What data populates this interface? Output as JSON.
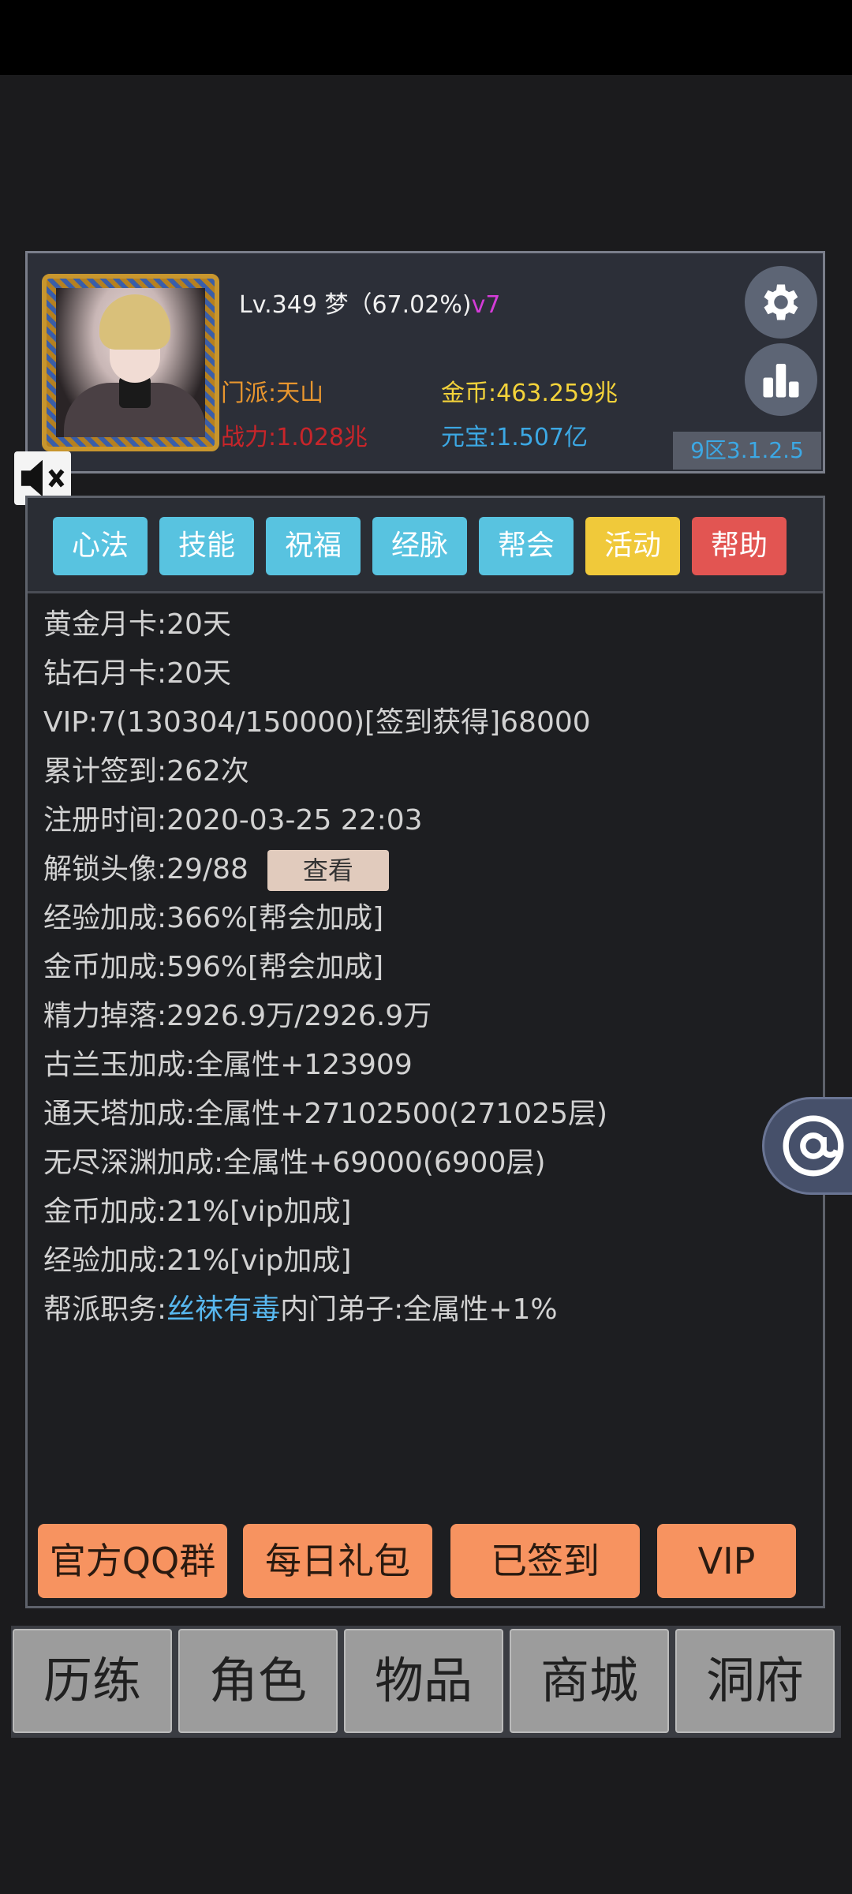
{
  "player": {
    "level_line": "Lv.349 梦（67.02%)",
    "vip_tag": "v7",
    "sect": "门派:天山",
    "power": "战力:1.028兆",
    "gold": "金币:463.259兆",
    "ingot": "元宝:1.507亿",
    "version": "9区3.1.2.5"
  },
  "tabs": [
    {
      "label": "心法",
      "color": "#58c3e0"
    },
    {
      "label": "技能",
      "color": "#58c3e0"
    },
    {
      "label": "祝福",
      "color": "#58c3e0"
    },
    {
      "label": "经脉",
      "color": "#58c3e0"
    },
    {
      "label": "帮会",
      "color": "#58c3e0"
    },
    {
      "label": "活动",
      "color": "#f0c93a"
    },
    {
      "label": "帮助",
      "color": "#e25552"
    }
  ],
  "info": {
    "gold_card": "黄金月卡:20天",
    "diamond_card": "钻石月卡:20天",
    "vip": "VIP:7(130304/150000)[签到获得]68000",
    "checkin_total": "累计签到:262次",
    "register_time": "注册时间:2020-03-25 22:03",
    "avatars_unlocked": "解锁头像:29/88",
    "view_button": "查看",
    "exp_bonus_guild": "经验加成:366%[帮会加成]",
    "gold_bonus_guild": "金币加成:596%[帮会加成]",
    "energy_drop": "精力掉落:2926.9万/2926.9万",
    "gulan_jade": "古兰玉加成:全属性+123909",
    "tower_bonus": "通天塔加成:全属性+27102500(271025层)",
    "abyss_bonus": "无尽深渊加成:全属性+69000(6900层)",
    "gold_bonus_vip": "金币加成:21%[vip加成]",
    "exp_bonus_vip": "经验加成:21%[vip加成]",
    "guild_role_prefix": "帮派职务:",
    "guild_name": "丝袜有毒",
    "guild_role_suffix": "内门弟子:全属性+1%"
  },
  "bottom_buttons": [
    "官方QQ群",
    "每日礼包",
    "已签到",
    "VIP"
  ],
  "nav": [
    "历练",
    "角色",
    "物品",
    "商城",
    "洞府"
  ],
  "icons": {
    "settings": "gear-icon",
    "ranking": "bar-chart-icon",
    "mute": "speaker-mute-icon",
    "at": "at-sign-icon"
  },
  "colors": {
    "tab_blue": "#58c3e0",
    "tab_yellow": "#f0c93a",
    "tab_red": "#e25552",
    "action_orange": "#f79360",
    "sect_orange": "#e8962e",
    "power_red": "#c8252a",
    "gold_yellow": "#f4d33a",
    "ingot_blue": "#3ca8e4",
    "vip_magenta": "#d43cd8"
  }
}
